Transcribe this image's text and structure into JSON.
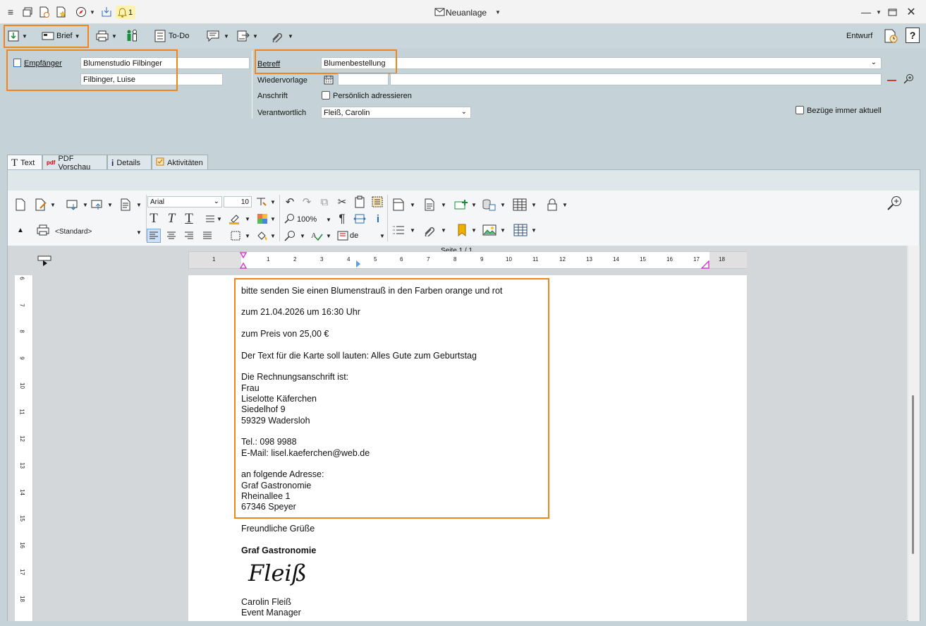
{
  "window": {
    "title": "Neuanlage",
    "notification_count": "1"
  },
  "toolbar": {
    "brief_label": "Brief",
    "todo_label": "To-Do",
    "status_label": "Entwurf"
  },
  "form": {
    "empfaenger_label": "Empfänger",
    "empfaenger_company": "Blumenstudio Filbinger",
    "empfaenger_person": "Filbinger, Luise",
    "betreff_label": "Betreff",
    "betreff_value": "Blumenbestellung",
    "wiedervorlage_label": "Wiedervorlage",
    "anschrift_label": "Anschrift",
    "persoenlich_label": "Persönlich adressieren",
    "verantwortlich_label": "Verantwortlich",
    "verantwortlich_value": "Fleiß, Carolin",
    "bezuege_label": "Bezüge immer aktuell"
  },
  "tabs": [
    {
      "label": "Text"
    },
    {
      "label": "PDF Vorschau"
    },
    {
      "label": "Details"
    },
    {
      "label": "Aktivitäten"
    }
  ],
  "editor": {
    "font_name": "Arial",
    "font_size": "10",
    "style_name": "<Standard>",
    "zoom": "100%",
    "language": "de",
    "page_indicator": "Seite 1 / 1"
  },
  "ruler": {
    "h_numbers": [
      "1",
      "1",
      "2",
      "3",
      "4",
      "5",
      "6",
      "7",
      "8",
      "9",
      "10",
      "11",
      "12",
      "13",
      "14",
      "15",
      "16",
      "17",
      "18"
    ],
    "v_numbers": [
      "6",
      "7",
      "8",
      "9",
      "10",
      "11",
      "12",
      "13",
      "14",
      "15",
      "16",
      "17",
      "18"
    ]
  },
  "document": {
    "lines": [
      "bitte senden Sie einen Blumenstrauß in den Farben orange und rot",
      "zum 21.04.2026 um 16:30 Uhr",
      "zum Preis von 25,00 €",
      "Der Text für die Karte soll lauten: Alles Gute zum Geburtstag",
      "Die Rechnungsanschrift ist:",
      "Frau",
      "Liselotte Käferchen",
      "Siedelhof 9",
      "59329 Wadersloh",
      "Tel.: 098 9988",
      "E-Mail: lisel.kaeferchen@web.de",
      "an folgende Adresse:",
      "Graf Gastronomie",
      "Rheinallee 1",
      "67346 Speyer",
      "Freundliche Grüße",
      "Graf Gastronomie",
      "Carolin Fleiß",
      "Event Manager"
    ],
    "signature": "Fleiß"
  }
}
